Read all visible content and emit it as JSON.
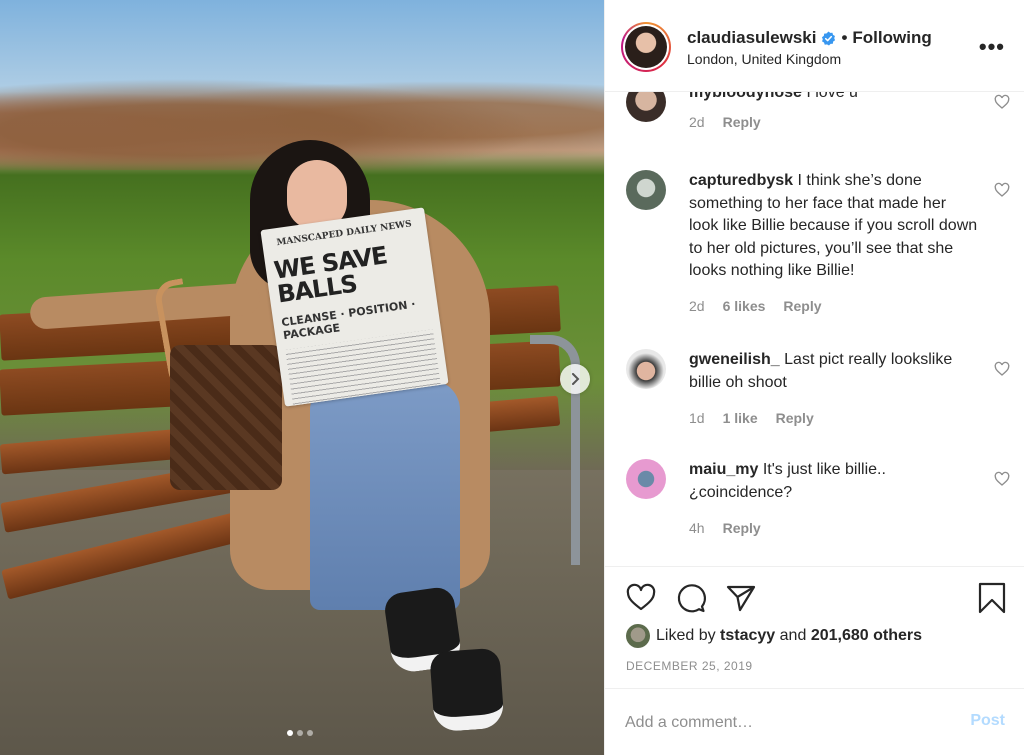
{
  "post": {
    "image_alt": "Woman reading newspaper on a park bench",
    "carousel": {
      "current": 1,
      "total": 3
    },
    "newspaper": {
      "masthead": "MANSCAPED DAILY NEWS",
      "headline": "WE SAVE BALLS",
      "sub": "CLEANSE · POSITION · PACKAGE"
    }
  },
  "header": {
    "username": "claudiasulewski",
    "verified": true,
    "separator": "•",
    "follow_status": "Following",
    "location": "London, United Kingdom",
    "more_icon": "more-horizontal-icon",
    "more_label": "•••"
  },
  "comments": [
    {
      "username": "mybloodynose",
      "text": "I love u",
      "age": "2d",
      "likes": "",
      "reply": "Reply"
    },
    {
      "username": "capturedbysk",
      "text": "I think she’s done something to her face that made her look like Billie because if you scroll down to her old pictures, you’ll see that she looks nothing like Billie!",
      "age": "2d",
      "likes": "6 likes",
      "reply": "Reply"
    },
    {
      "username": "gweneilish_",
      "text": "Last pict really lookslike billie oh shoot",
      "age": "1d",
      "likes": "1 like",
      "reply": "Reply"
    },
    {
      "username": "maiu_my",
      "text": "It's just like billie.. ¿coincidence?",
      "age": "4h",
      "likes": "",
      "reply": "Reply"
    }
  ],
  "actions": {
    "like_icon": "heart-icon",
    "comment_icon": "comment-bubble-icon",
    "share_icon": "paper-plane-icon",
    "save_icon": "bookmark-icon",
    "liked_by_prefix": "Liked by",
    "liked_by_user": "tstacyy",
    "liked_by_and": "and",
    "liked_by_others": "201,680 others",
    "date": "DECEMBER 25, 2019"
  },
  "add_comment": {
    "placeholder": "Add a comment…",
    "post_label": "Post"
  },
  "colors": {
    "text": "#262626",
    "secondary": "#8e8e8e",
    "border": "#efefef",
    "post_disabled": "#b3dbff",
    "verified_blue": "#3897f0"
  }
}
